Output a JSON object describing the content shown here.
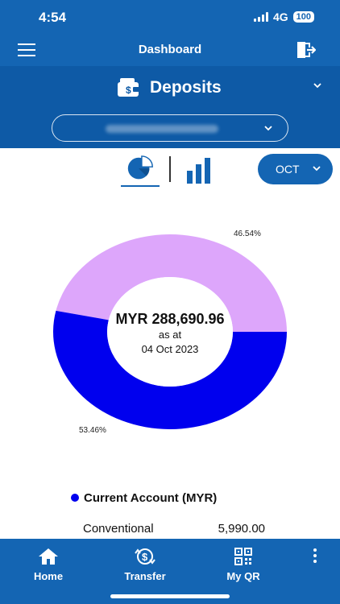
{
  "status_bar": {
    "time": "4:54",
    "network": "4G",
    "battery": "100"
  },
  "header": {
    "title": "Dashboard"
  },
  "deposits": {
    "label": "Deposits"
  },
  "filters": {
    "month": "OCT"
  },
  "summary": {
    "amount": "MYR 288,690.96",
    "as_at_label": "as at",
    "date": "04 Oct 2023"
  },
  "chart_data": {
    "type": "pie",
    "categories": [
      "",
      ""
    ],
    "values": [
      46.54,
      53.46
    ],
    "labels": [
      "46.54%",
      "53.46%"
    ],
    "colors": [
      "#dda6fb",
      "#0000ee"
    ]
  },
  "legend": {
    "label": "Current Account (MYR)",
    "color": "#0000ee"
  },
  "details": [
    {
      "name": "Conventional",
      "value": "5,990.00"
    }
  ],
  "nav": [
    {
      "label": "Home",
      "icon": "home-icon"
    },
    {
      "label": "Transfer",
      "icon": "transfer-icon"
    },
    {
      "label": "My QR",
      "icon": "qr-icon"
    }
  ],
  "colors": {
    "primary": "#1465b3",
    "header_dark": "#0e5aa6"
  }
}
